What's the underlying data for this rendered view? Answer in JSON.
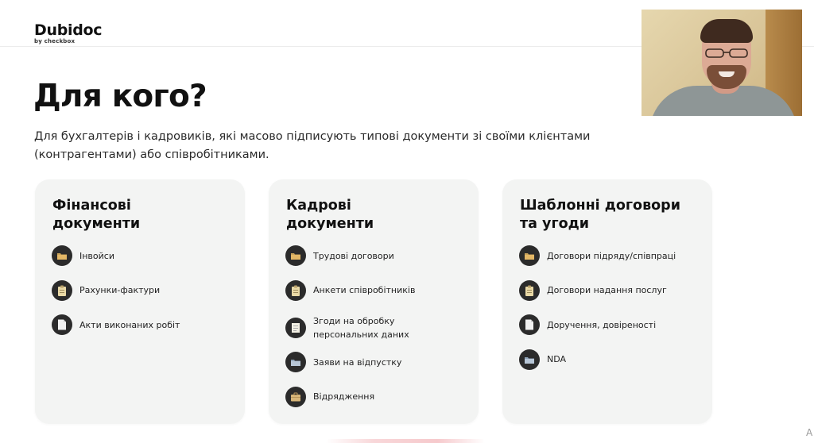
{
  "header": {
    "logo_name": "Dubidoc",
    "logo_sub": "by checkbox"
  },
  "main": {
    "title": "Для кого?",
    "subtitle": "Для бухгалтерів і кадровиків, які масово підписують типові документи зі своїми клієнтами (контрагентами) або співробітниками."
  },
  "cards": [
    {
      "title": "Фінансові\nдокументи",
      "items": [
        {
          "label": "Інвойси",
          "icon": "folder-icon"
        },
        {
          "label": "Рахунки-фактури",
          "icon": "clipboard-icon"
        },
        {
          "label": "Акти виконаних робіт",
          "icon": "document-icon"
        }
      ]
    },
    {
      "title": "Кадрові\nдокументи",
      "items": [
        {
          "label": "Трудові договори",
          "icon": "folder-icon"
        },
        {
          "label": "Анкети співробітників",
          "icon": "clipboard-icon"
        },
        {
          "label": "Згоди на обробку\nперсональних даних",
          "icon": "memo-icon"
        },
        {
          "label": "Заяви на відпустку",
          "icon": "folder-icon"
        },
        {
          "label": "Відрядження",
          "icon": "briefcase-icon"
        }
      ]
    },
    {
      "title": "Шаблонні договори\nта угоди",
      "items": [
        {
          "label": "Договори підряду/співпраці",
          "icon": "folder-icon"
        },
        {
          "label": "Договори надання послуг",
          "icon": "clipboard-icon"
        },
        {
          "label": "Доручення, довіреності",
          "icon": "document-icon"
        },
        {
          "label": "NDA",
          "icon": "folder-icon"
        }
      ]
    }
  ],
  "corner_mark": "A",
  "colors": {
    "card_bg": "#f3f4f3",
    "icon_circle": "#2b2b2b",
    "text": "#111111"
  }
}
